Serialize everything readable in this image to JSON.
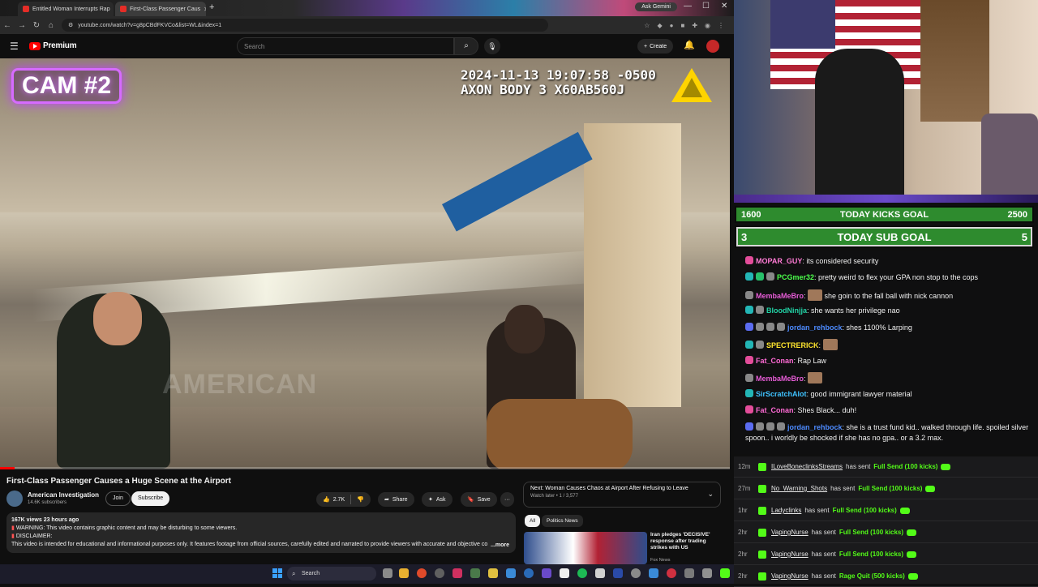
{
  "browser": {
    "tabs": [
      {
        "label": "Entitled Woman Interrupts Rap"
      },
      {
        "label": "First-Class Passenger Caus"
      }
    ],
    "new_tab": "+",
    "ask_gemini": "Ask Gemini",
    "url": "youtube.com/watch?v=g8pCBdFKVCo&list=WL&index=1",
    "controls": {
      "minimize": "—",
      "maximize": "☐",
      "close": "✕"
    }
  },
  "youtube": {
    "brand": "Premium",
    "search_placeholder": "Search",
    "create_label": "Create",
    "video": {
      "cam_label": "CAM #2",
      "timestamp_line1": "2024-11-13 19:07:58 -0500",
      "timestamp_line2": "AXON BODY 3 X60AB560J",
      "watermark": "AMERICAN",
      "progress_fraction": 0.02
    },
    "title": "First-Class Passenger Causes a Huge Scene at the Airport",
    "channel": {
      "name": "American Investigation",
      "subs": "14.6K subscribers",
      "join": "Join",
      "subscribe": "Subscribe"
    },
    "actions": {
      "likes": "2.7K",
      "share": "Share",
      "ask": "Ask",
      "save": "Save",
      "more": "···"
    },
    "description": {
      "meta": "167K views  23 hours ago",
      "line1": "WARNING: This video contains graphic content and may be disturbing to some viewers.",
      "line2": "DISCLAIMER:",
      "line3": "This video is intended for educational and informational purposes only. It features footage from official sources, carefully edited and narrated to provide viewers with accurate and objective co",
      "more": "...more"
    },
    "up_next": {
      "title": "Next: Woman Causes Chaos at Airport After Refusing to Leave",
      "sub": "Watch later • 1 / 3,577"
    },
    "chips": [
      "All",
      "Politics News"
    ],
    "recommendation": {
      "title": "Iran pledges 'DECISIVE' response after trading strikes with US",
      "channel": "Fox News"
    }
  },
  "taskbar": {
    "search_label": "Search"
  },
  "stream": {
    "kicks_goal": {
      "current": "1600",
      "label": "TODAY KICKS GOAL",
      "target": "2500"
    },
    "sub_goal": {
      "current": "3",
      "label": "TODAY SUB GOAL",
      "target": "5"
    },
    "chat": [
      {
        "user": "MOPAR_GUY",
        "color": "#ff7bd5",
        "badges": [
          "pink"
        ],
        "msg": "its considered security"
      },
      {
        "user": "PCGmer32",
        "color": "#4cff4c",
        "badges": [
          "teal",
          "green",
          "gray"
        ],
        "msg": "pretty weird to flex your GPA non stop to the cops"
      },
      {
        "user": "MembaMeBro",
        "color": "#e65cd6",
        "badges": [
          "gray"
        ],
        "msg": "she goin to the fall ball with nick cannon",
        "emote_before": true
      },
      {
        "user": "BloodNinjja",
        "color": "#22d3a6",
        "badges": [
          "teal",
          "gray"
        ],
        "msg": "she wants her privilege nao"
      },
      {
        "user": "jordan_rehbock",
        "color": "#4d8bff",
        "badges": [
          "blue",
          "gray",
          "gray",
          "gray"
        ],
        "msg": "shes 1100% Larping"
      },
      {
        "user": "SPECTRERICK",
        "color": "#ffe62e",
        "badges": [
          "teal",
          "gray"
        ],
        "msg": "",
        "emote_after": true
      },
      {
        "user": "Fat_Conan",
        "color": "#ff6ad5",
        "badges": [
          "pink"
        ],
        "msg": "Rap Law"
      },
      {
        "user": "MembaMeBro",
        "color": "#e65cd6",
        "badges": [
          "gray"
        ],
        "msg": "",
        "emote_after": true
      },
      {
        "user": "SirScratchAlot",
        "color": "#3fc3ff",
        "badges": [
          "teal"
        ],
        "msg": "good immigrant lawyer material"
      },
      {
        "user": "Fat_Conan",
        "color": "#ff6ad5",
        "badges": [
          "pink"
        ],
        "msg": "Shes Black... duh!"
      },
      {
        "user": "jordan_rehbock",
        "color": "#4d8bff",
        "badges": [
          "blue",
          "gray",
          "gray",
          "gray"
        ],
        "msg": "she is a trust fund kid.. walked through life. spoiled silver spoon.. i worldly be shocked if she has no gpa.. or a 3.2 max."
      }
    ],
    "events": [
      {
        "time": "12m",
        "user": "ILoveBoneclinksStreams",
        "action": "has sent",
        "gift": "Full Send (100 kicks)"
      },
      {
        "time": "27m",
        "user": "No_Warning_Shots",
        "action": "has sent",
        "gift": "Full Send (100 kicks)"
      },
      {
        "time": "1hr",
        "user": "Ladyclinks",
        "action": "has sent",
        "gift": "Full Send (100 kicks)"
      },
      {
        "time": "2hr",
        "user": "VapingNurse",
        "action": "has sent",
        "gift": "Full Send (100 kicks)"
      },
      {
        "time": "2hr",
        "user": "VapingNurse",
        "action": "has sent",
        "gift": "Full Send (100 kicks)"
      },
      {
        "time": "2hr",
        "user": "VapingNurse",
        "action": "has sent",
        "gift": "Rage Quit (500 kicks)"
      }
    ],
    "colors": {
      "goal_green": "#2e8b2e",
      "kick_green": "#53fc18"
    }
  }
}
